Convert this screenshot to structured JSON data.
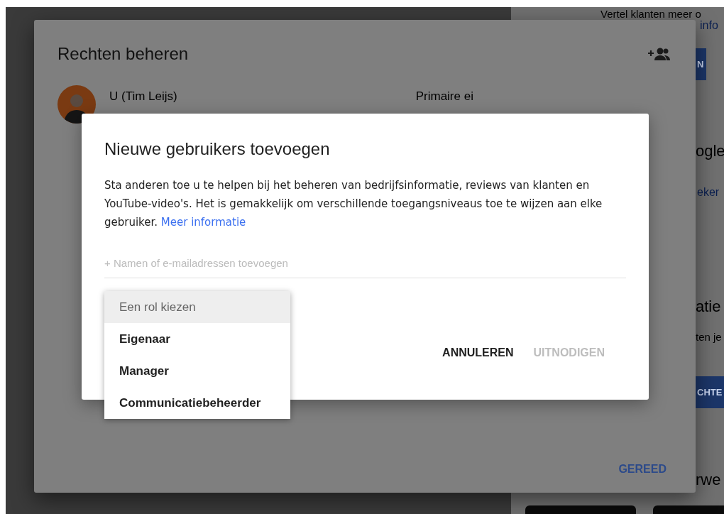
{
  "background_page": {
    "right_texts": [
      {
        "kind": "text",
        "text": "Vertel klanten meer o"
      },
      {
        "kind": "link",
        "text": "info"
      },
      {
        "kind": "button",
        "text": "N"
      },
      {
        "kind": "heading",
        "text": "ogle"
      },
      {
        "kind": "link",
        "text": "eker"
      },
      {
        "kind": "heading",
        "text": "atie"
      },
      {
        "kind": "text",
        "text": "ten je"
      },
      {
        "kind": "button",
        "text": "CHTE"
      },
      {
        "kind": "heading",
        "text": "rwe"
      }
    ]
  },
  "permissions_dialog": {
    "title": "Rechten beheren",
    "users": [
      {
        "name": "U (Tim Leijs)",
        "role": "Primaire ei"
      }
    ],
    "done_button": "GEREED"
  },
  "add_users_dialog": {
    "title": "Nieuwe gebruikers toevoegen",
    "description": "Sta anderen toe u te helpen bij het beheren van bedrijfsinformatie, reviews van klanten en YouTube-video's. Het is gemakkelijk om verschillende toegangsniveaus toe te wijzen aan elke gebruiker.",
    "link": "Meer informatie",
    "input": {
      "placeholder": "+ Namen of e-mailadressen toevoegen"
    },
    "role_menu": [
      {
        "label": "Een rol kiezen",
        "selected": true,
        "disabled": true
      },
      {
        "label": "Eigenaar",
        "selected": false,
        "disabled": false
      },
      {
        "label": "Manager",
        "selected": false,
        "disabled": false
      },
      {
        "label": "Communicatiebeheerder",
        "selected": false,
        "disabled": false
      }
    ],
    "buttons": [
      {
        "label": "ANNULEREN",
        "disabled": false
      },
      {
        "label": "UITNODIGEN",
        "disabled": true
      }
    ]
  }
}
